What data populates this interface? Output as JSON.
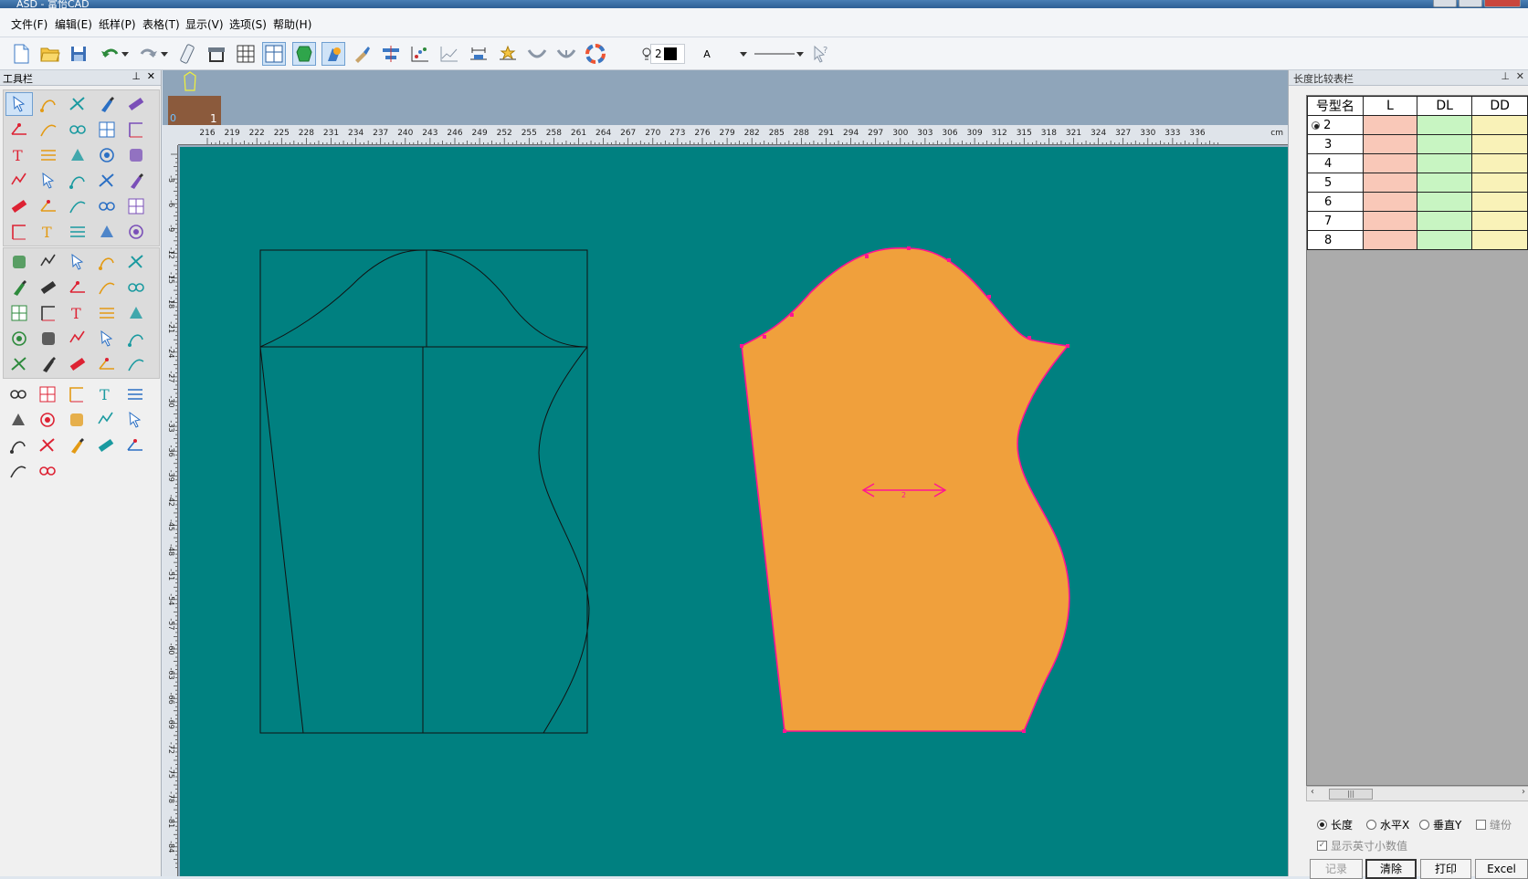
{
  "window": {
    "title": "ASD - 富怡CAD"
  },
  "menu": {
    "items": [
      "文件(F)",
      "编辑(E)",
      "纸样(P)",
      "表格(T)",
      "显示(V)",
      "选项(S)",
      "帮助(H)"
    ]
  },
  "toolbar": {
    "line_width": "2",
    "font_label": "A"
  },
  "tool_panel": {
    "title": "工具栏"
  },
  "piece_strip": {
    "label_0": "0",
    "label_1": "1"
  },
  "ruler": {
    "h_ticks": [
      "216",
      "219",
      "222",
      "225",
      "228",
      "231",
      "234",
      "237",
      "240",
      "243",
      "246",
      "249",
      "252",
      "255",
      "258",
      "261",
      "264",
      "267",
      "270",
      "273",
      "276",
      "279",
      "282",
      "285",
      "288",
      "291",
      "294",
      "297",
      "300",
      "303",
      "306",
      "309",
      "312",
      "315",
      "318",
      "321",
      "324",
      "327",
      "330",
      "333",
      "336"
    ],
    "h_unit": "cm",
    "v_ticks": [
      "-3",
      "-6",
      "-9",
      "-12",
      "-15",
      "-18",
      "-21",
      "-24",
      "-27",
      "-30",
      "-33",
      "-36",
      "-39",
      "-42",
      "-45",
      "-48",
      "-51",
      "-54",
      "-57",
      "-60",
      "-63",
      "-66",
      "-69",
      "-72",
      "-75",
      "-78",
      "-81",
      "-84"
    ]
  },
  "canvas": {
    "grain_label": "2",
    "bg_color": "#008080",
    "piece_fill": "#f0a03c",
    "outline_color": "#ff1493"
  },
  "length_panel": {
    "title": "长度比较表栏",
    "columns": [
      "号型名",
      "L",
      "DL",
      "DD"
    ],
    "rows": [
      "2",
      "3",
      "4",
      "5",
      "6",
      "7",
      "8"
    ],
    "selected_row": "2",
    "options": {
      "length": "长度",
      "horizontal": "水平X",
      "vertical": "垂直Y",
      "seam": "缝份",
      "show_inch": "显示英寸小数值"
    },
    "scroll_thumb": "|||",
    "buttons": {
      "record": "记录",
      "clear": "清除",
      "print": "打印",
      "excel": "Excel"
    }
  }
}
